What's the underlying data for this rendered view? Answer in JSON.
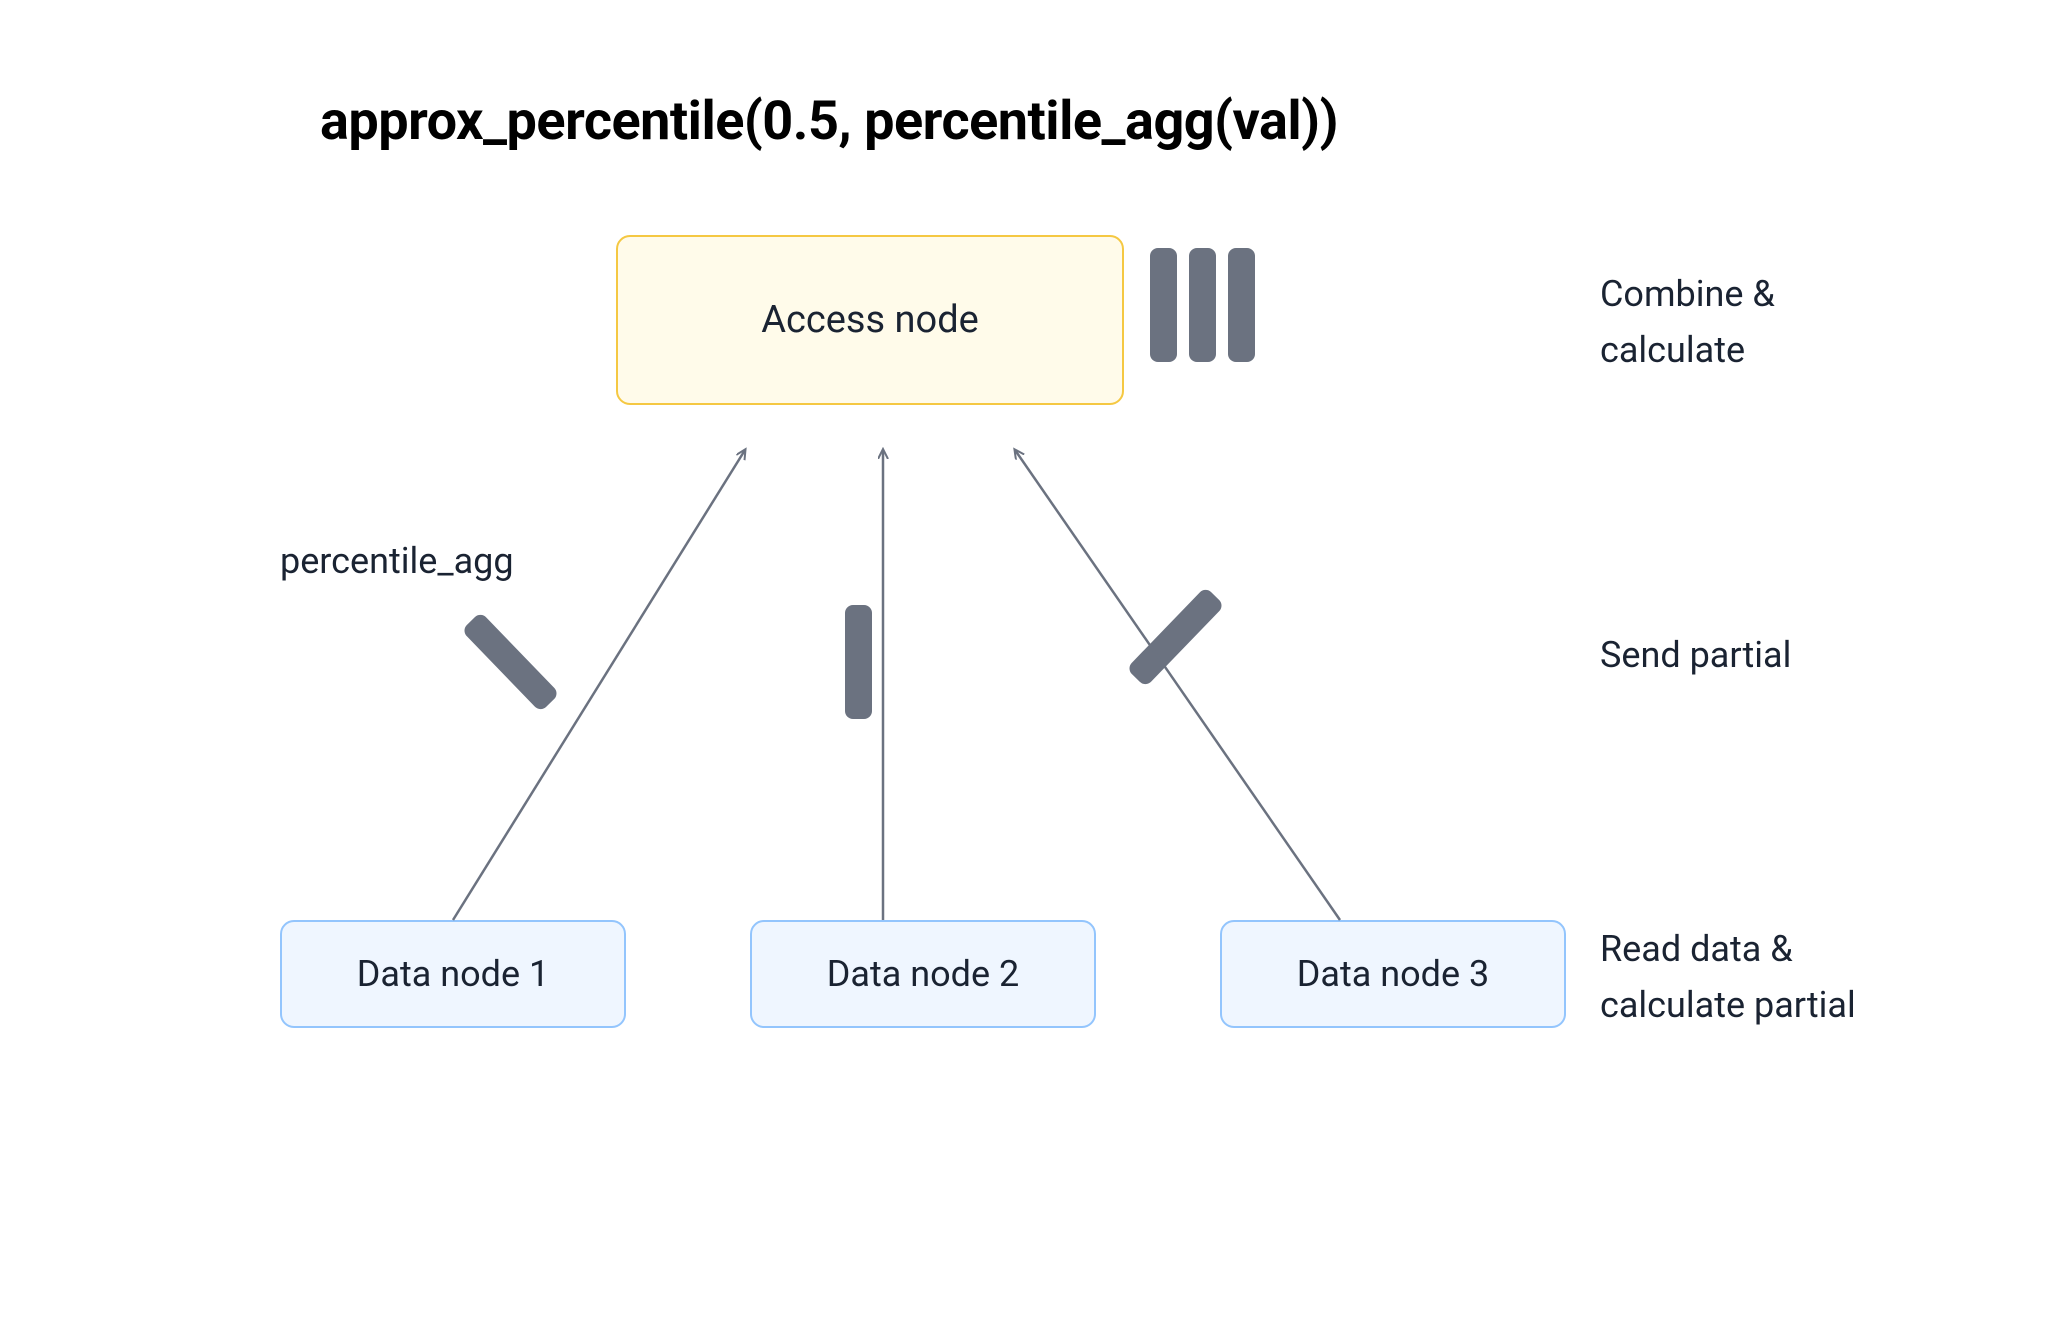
{
  "title": "approx_percentile(0.5, percentile_agg(val))",
  "nodes": {
    "access": "Access node",
    "data1": "Data node 1",
    "data2": "Data node 2",
    "data3": "Data node 3"
  },
  "labels": {
    "combine": "Combine &\ncalculate",
    "send": "Send partial",
    "read": "Read data &\ncalculate partial",
    "percentile": "percentile_agg"
  },
  "colors": {
    "accessFill": "#fffbea",
    "accessBorder": "#f5c842",
    "dataFill": "#eff6ff",
    "dataBorder": "#93c5fd",
    "bar": "#6b7280",
    "arrow": "#6b7280"
  }
}
